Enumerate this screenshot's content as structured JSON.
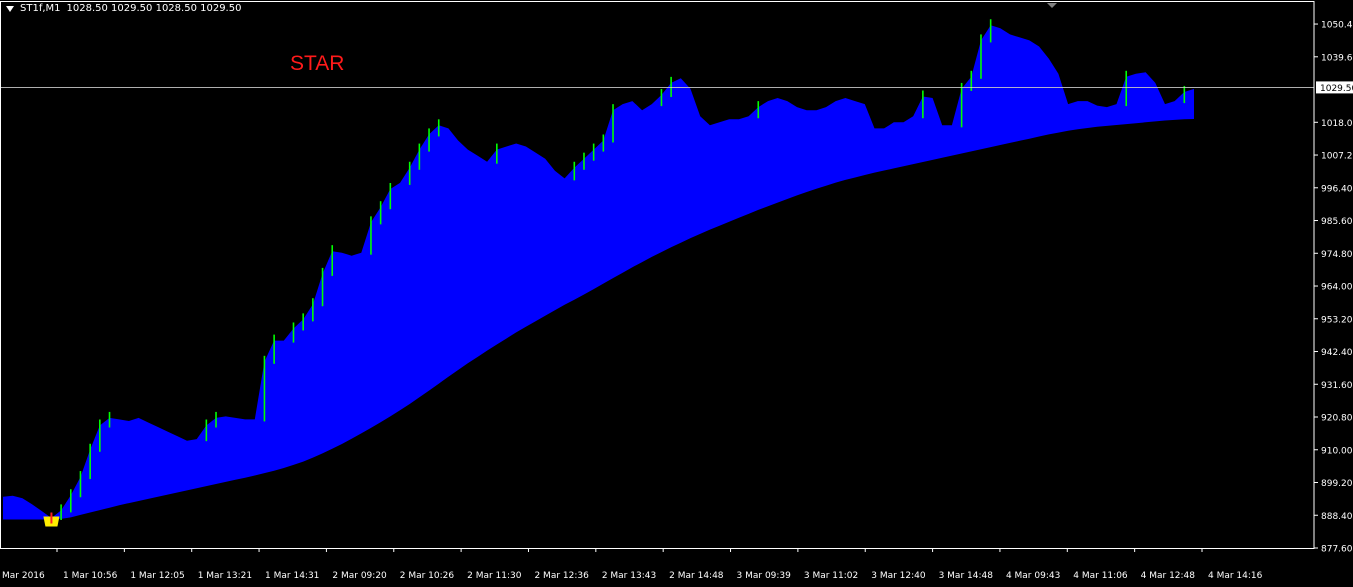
{
  "header": {
    "symbol": "ST1f,M1",
    "ohlc": "1028.50 1029.50 1028.50 1029.50"
  },
  "overlay_label": "STAR",
  "colors": {
    "background": "#000000",
    "frame": "#ffffff",
    "area": "#0000ff",
    "up_spikes": "#00ff00",
    "label": "#ff1a1a",
    "signal": "#ffee00",
    "signal_mark": "#ff2020"
  },
  "chart_data": {
    "type": "area",
    "title": "",
    "xlabel": "",
    "ylabel": "",
    "ylim": [
      877.6,
      1058.0
    ],
    "y_ticks": [
      1050.4,
      1039.6,
      1018.0,
      1007.2,
      996.4,
      985.6,
      974.8,
      964.0,
      953.2,
      942.4,
      931.6,
      920.8,
      910.0,
      899.2,
      888.4,
      877.6
    ],
    "current_price": 1029.5,
    "x_tick_labels": [
      "Mar 2016",
      "1 Mar 10:56",
      "1 Mar 12:05",
      "1 Mar 13:21",
      "1 Mar 14:31",
      "2 Mar 09:20",
      "2 Mar 10:26",
      "2 Mar 11:30",
      "2 Mar 12:36",
      "2 Mar 13:43",
      "2 Mar 14:48",
      "3 Mar 09:39",
      "3 Mar 11:02",
      "3 Mar 12:40",
      "3 Mar 14:48",
      "4 Mar 09:43",
      "4 Mar 11:06",
      "4 Mar 12:48",
      "4 Mar 14:16"
    ],
    "series": [
      {
        "values": [
          894.5,
          894.8,
          894.0,
          892.0,
          889.8,
          887.5,
          890.0,
          895.0,
          901.0,
          910.0,
          918.0,
          920.5,
          920.0,
          919.5,
          920.5,
          919.0,
          917.5,
          916.0,
          914.5,
          913.0,
          913.5,
          918.0,
          920.5,
          921.0,
          920.5,
          920.0,
          920.0,
          939.0,
          946.0,
          946.0,
          950.0,
          953.0,
          958.0,
          968.0,
          975.5,
          975.0,
          974.0,
          975.0,
          985.0,
          990.0,
          996.0,
          998.0,
          1003.0,
          1009.0,
          1014.0,
          1017.0,
          1016.0,
          1012.0,
          1009.0,
          1007.0,
          1005.0,
          1009.0,
          1010.0,
          1011.0,
          1010.0,
          1008.0,
          1006.0,
          1002.0,
          999.5,
          1003.0,
          1006.0,
          1009.0,
          1012.0,
          1022.0,
          1024.0,
          1025.0,
          1022.0,
          1024.0,
          1027.0,
          1031.0,
          1032.5,
          1029.0,
          1020.0,
          1017.0,
          1018.0,
          1019.0,
          1019.0,
          1020.0,
          1023.0,
          1025.0,
          1026.0,
          1025.0,
          1023.0,
          1022.0,
          1022.0,
          1023.0,
          1025.0,
          1026.0,
          1025.0,
          1024.0,
          1016.0,
          1016.0,
          1018.0,
          1018.0,
          1020.0,
          1026.5,
          1026.0,
          1017.0,
          1017.0,
          1029.0,
          1033.0,
          1045.0,
          1050.0,
          1049.0,
          1047.0,
          1046.0,
          1045.0,
          1043.0,
          1039.0,
          1034.0,
          1024.0,
          1025.0,
          1025.0,
          1023.5,
          1023.0,
          1024.0,
          1033.0,
          1034.0,
          1034.5,
          1031.0,
          1024.0,
          1025.0,
          1028.0,
          1029.0
        ]
      },
      {
        "values": [
          887.0,
          887.0,
          887.0,
          887.0,
          887.0,
          887.0,
          887.2,
          887.7,
          888.5,
          889.3,
          890.1,
          890.9,
          891.7,
          892.4,
          893.1,
          893.8,
          894.5,
          895.2,
          895.9,
          896.6,
          897.3,
          898.0,
          898.7,
          899.4,
          900.1,
          900.8,
          901.5,
          902.3,
          903.1,
          904.0,
          905.0,
          906.1,
          907.4,
          908.8,
          910.3,
          911.9,
          913.6,
          915.4,
          917.2,
          919.1,
          921.0,
          923.0,
          925.1,
          927.3,
          929.5,
          931.8,
          934.1,
          936.3,
          938.5,
          940.6,
          942.7,
          944.7,
          946.7,
          948.7,
          950.6,
          952.4,
          954.2,
          956.0,
          957.8,
          959.5,
          961.2,
          963.0,
          964.8,
          966.6,
          968.4,
          970.2,
          971.9,
          973.6,
          975.2,
          976.8,
          978.3,
          979.8,
          981.2,
          982.6,
          983.9,
          985.2,
          986.5,
          987.8,
          989.1,
          990.3,
          991.5,
          992.7,
          993.9,
          995.0,
          996.1,
          997.1,
          998.1,
          999.0,
          999.8,
          1000.6,
          1001.4,
          1002.1,
          1002.8,
          1003.5,
          1004.2,
          1004.9,
          1005.6,
          1006.3,
          1007.0,
          1007.7,
          1008.4,
          1009.1,
          1009.8,
          1010.5,
          1011.2,
          1011.9,
          1012.6,
          1013.3,
          1014.0,
          1014.6,
          1015.2,
          1015.7,
          1016.1,
          1016.5,
          1016.8,
          1017.1,
          1017.4,
          1017.7,
          1018.0,
          1018.3,
          1018.6,
          1018.8,
          1019.0,
          1019.1
        ]
      }
    ],
    "signal": {
      "index": 5,
      "value": 887.0
    }
  }
}
